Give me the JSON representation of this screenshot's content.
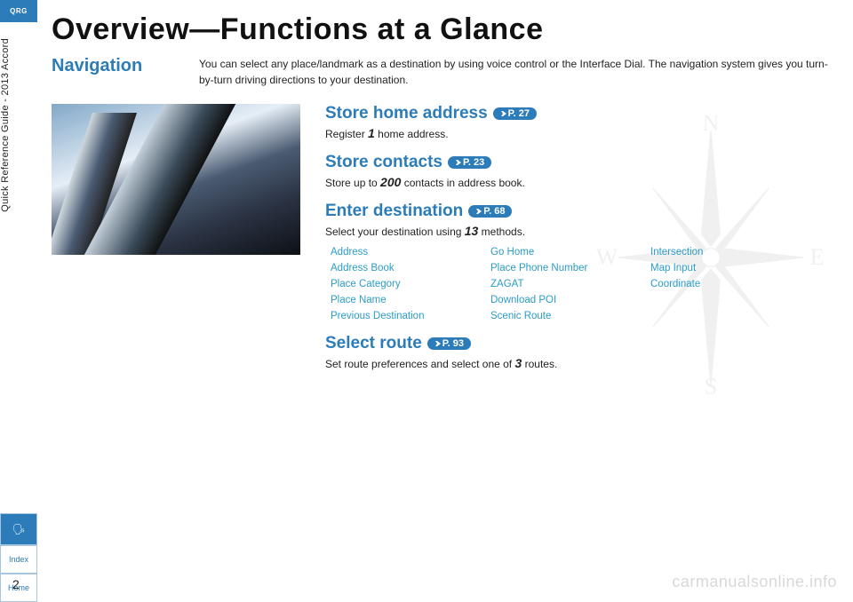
{
  "sidebar": {
    "qrg": "QRG",
    "guide": "Quick Reference Guide - 2013 Accord",
    "voice_icon": "🗣",
    "index": "Index",
    "home": "Home"
  },
  "page_number": "2",
  "title": "Overview—Functions at a Glance",
  "nav_label": "Navigation",
  "intro": "You can select any place/landmark as a destination by using voice control or the Interface Dial. The navigation system gives you turn-by-turn driving directions to your destination.",
  "sections": {
    "home_addr": {
      "title": "Store home address",
      "page": "P. 27",
      "sub_pre": "Register ",
      "sub_b": "1",
      "sub_post": " home address."
    },
    "contacts": {
      "title": "Store contacts",
      "page": "P. 23",
      "sub_pre": "Store up to ",
      "sub_b": "200",
      "sub_post": " contacts in address book."
    },
    "enter_dest": {
      "title": "Enter destination",
      "page": "P. 68",
      "sub_pre": "Select your destination using ",
      "sub_b": "13",
      "sub_post": " methods."
    },
    "select_route": {
      "title": "Select route",
      "page": "P. 93",
      "sub_pre": "Set route preferences and select one of ",
      "sub_b": "3",
      "sub_post": " routes."
    }
  },
  "methods": [
    "Address",
    "Go Home",
    "Intersection",
    "Address Book",
    "Place Phone Number",
    "Map Input",
    "Place Category",
    "ZAGAT",
    "Coordinate",
    "Place Name",
    "Download POI",
    "",
    "Previous Destination",
    "Scenic Route",
    ""
  ],
  "watermark": "carmanualsonline.info",
  "compass": {
    "N": "N",
    "E": "E",
    "S": "S",
    "W": "W"
  }
}
